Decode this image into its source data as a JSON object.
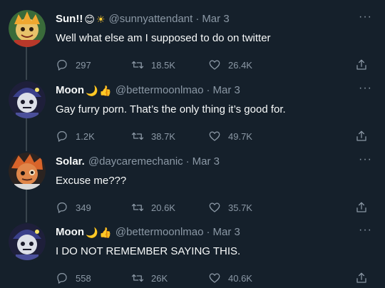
{
  "tweets": [
    {
      "name": "Sun!!",
      "emojis": [
        "😊",
        "☀"
      ],
      "handle": "@sunnyattendant",
      "separator": "·",
      "date": "Mar 3",
      "text": "Well what else am I supposed to do on twitter",
      "replies": "297",
      "retweets": "18.5K",
      "likes": "26.4K",
      "avatar_color": "#9a3a2e"
    },
    {
      "name": "Moon",
      "emojis": [
        "🌙",
        "👍"
      ],
      "handle": "@bettermoonlmao",
      "separator": "·",
      "date": "Mar 3",
      "text": "Gay furry porn. That’s the only thing it’s good for.",
      "replies": "1.2K",
      "retweets": "38.7K",
      "likes": "49.7K",
      "avatar_color": "#2a2d5c"
    },
    {
      "name": "Solar.",
      "emojis": [],
      "handle": "@daycaremechanic",
      "separator": "·",
      "date": "Mar 3",
      "text": "Excuse me???",
      "replies": "349",
      "retweets": "20.6K",
      "likes": "35.7K",
      "avatar_color": "#c8552a"
    },
    {
      "name": "Moon",
      "emojis": [
        "🌙",
        "👍"
      ],
      "handle": "@bettermoonlmao",
      "separator": "·",
      "date": "Mar 3",
      "text": "I DO NOT REMEMBER SAYING THIS.",
      "replies": "558",
      "retweets": "26K",
      "likes": "40.6K",
      "avatar_color": "#2a2d5c"
    }
  ],
  "more_label": "···",
  "icons": {
    "reply": "reply-icon",
    "retweet": "retweet-icon",
    "like": "like-icon",
    "share": "share-icon"
  }
}
